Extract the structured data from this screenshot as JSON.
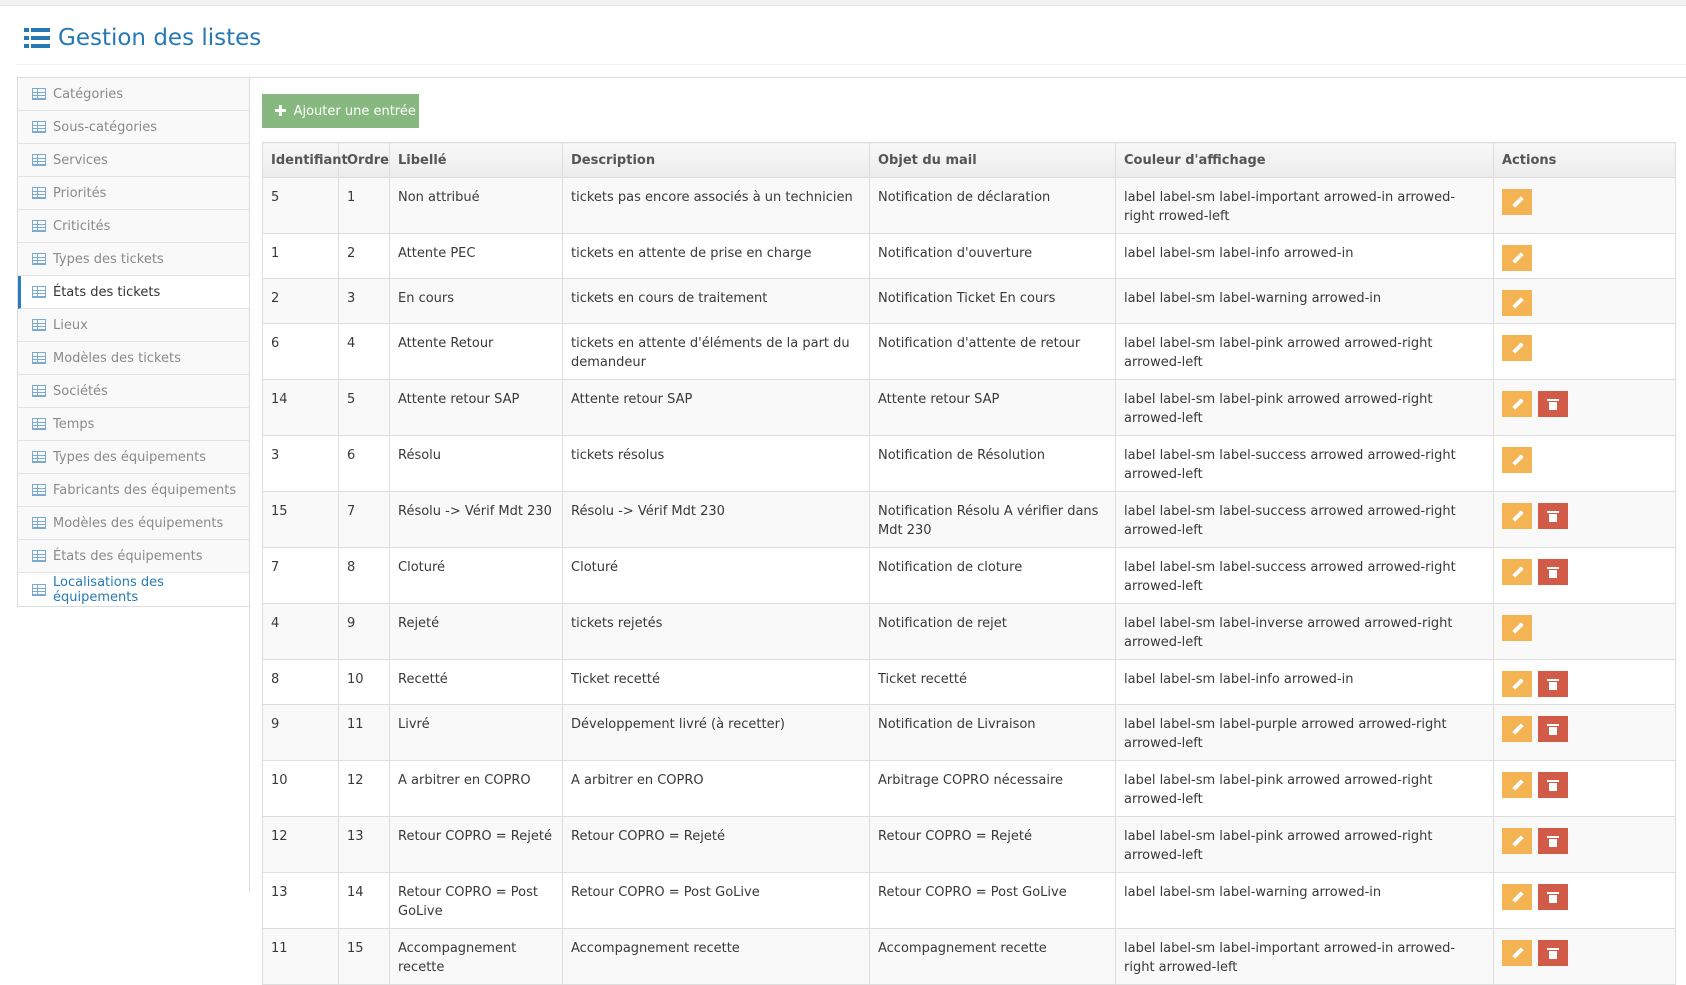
{
  "page": {
    "title": "Gestion des listes"
  },
  "sidebar": {
    "items": [
      {
        "label": "Catégories",
        "state": "normal"
      },
      {
        "label": "Sous-catégories",
        "state": "normal"
      },
      {
        "label": "Services",
        "state": "normal"
      },
      {
        "label": "Priorités",
        "state": "normal"
      },
      {
        "label": "Criticités",
        "state": "normal"
      },
      {
        "label": "Types des tickets",
        "state": "normal"
      },
      {
        "label": "États des tickets",
        "state": "active"
      },
      {
        "label": "Lieux",
        "state": "normal"
      },
      {
        "label": "Modèles des tickets",
        "state": "normal"
      },
      {
        "label": "Sociétés",
        "state": "normal"
      },
      {
        "label": "Temps",
        "state": "normal"
      },
      {
        "label": "Types des équipements",
        "state": "normal"
      },
      {
        "label": "Fabricants des équipements",
        "state": "normal"
      },
      {
        "label": "Modèles des équipements",
        "state": "normal"
      },
      {
        "label": "États des équipements",
        "state": "normal"
      },
      {
        "label": "Localisations des équipements",
        "state": "link"
      }
    ]
  },
  "toolbar": {
    "add_label": "Ajouter une entrée",
    "add_icon": "plus-icon"
  },
  "table": {
    "headers": [
      "Identifiant",
      "Ordre",
      "Libellé",
      "Description",
      "Objet du mail",
      "Couleur d'affichage",
      "Actions"
    ],
    "rows": [
      {
        "id": "5",
        "ordre": "1",
        "libelle": "Non attribué",
        "description": "tickets pas encore associés à un technicien",
        "objet": "Notification de déclaration",
        "couleur": "label label-sm label-important arrowed-in arrowed-right rrowed-left",
        "delete": false,
        "tall": true
      },
      {
        "id": "1",
        "ordre": "2",
        "libelle": "Attente PEC",
        "description": "tickets en attente de prise en charge",
        "objet": "Notification d'ouverture",
        "couleur": "label label-sm label-info arrowed-in",
        "delete": false,
        "tall": false
      },
      {
        "id": "2",
        "ordre": "3",
        "libelle": "En cours",
        "description": "tickets en cours de traitement",
        "objet": "Notification Ticket En cours",
        "couleur": "label label-sm label-warning arrowed-in",
        "delete": false,
        "tall": false
      },
      {
        "id": "6",
        "ordre": "4",
        "libelle": "Attente Retour",
        "description": "tickets en attente d'éléments de la part du demandeur",
        "objet": "Notification d'attente de retour",
        "couleur": "label label-sm label-pink arrowed arrowed-right arrowed-left",
        "delete": false,
        "tall": true
      },
      {
        "id": "14",
        "ordre": "5",
        "libelle": "Attente retour SAP",
        "description": "Attente retour SAP",
        "objet": "Attente retour SAP",
        "couleur": "label label-sm label-pink arrowed arrowed-right arrowed-left",
        "delete": true,
        "tall": false
      },
      {
        "id": "3",
        "ordre": "6",
        "libelle": "Résolu",
        "description": "tickets résolus",
        "objet": "Notification de Résolution",
        "couleur": "label label-sm label-success arrowed arrowed-right arrowed-left",
        "delete": false,
        "tall": false
      },
      {
        "id": "15",
        "ordre": "7",
        "libelle": "Résolu -> Vérif Mdt 230",
        "description": "Résolu -> Vérif Mdt 230",
        "objet": "Notification Résolu A vérifier dans Mdt 230",
        "couleur": "label label-sm label-success arrowed arrowed-right arrowed-left",
        "delete": true,
        "tall": true
      },
      {
        "id": "7",
        "ordre": "8",
        "libelle": "Cloturé",
        "description": "Cloturé",
        "objet": "Notification de cloture",
        "couleur": "label label-sm label-success arrowed arrowed-right arrowed-left",
        "delete": true,
        "tall": false
      },
      {
        "id": "4",
        "ordre": "9",
        "libelle": "Rejeté",
        "description": "tickets rejetés",
        "objet": "Notification de rejet",
        "couleur": "label label-sm label-inverse arrowed arrowed-right arrowed-left",
        "delete": false,
        "tall": false
      },
      {
        "id": "8",
        "ordre": "10",
        "libelle": "Recetté",
        "description": "Ticket recetté",
        "objet": "Ticket recetté",
        "couleur": "label label-sm label-info arrowed-in",
        "delete": true,
        "tall": false
      },
      {
        "id": "9",
        "ordre": "11",
        "libelle": "Livré",
        "description": "Développement livré (à recetter)",
        "objet": "Notification de Livraison",
        "couleur": "label label-sm label-purple arrowed arrowed-right arrowed-left",
        "delete": true,
        "tall": false
      },
      {
        "id": "10",
        "ordre": "12",
        "libelle": "A arbitrer en COPRO",
        "description": "A arbitrer en COPRO",
        "objet": "Arbitrage COPRO nécessaire",
        "couleur": "label label-sm label-pink arrowed arrowed-right arrowed-left",
        "delete": true,
        "tall": false
      },
      {
        "id": "12",
        "ordre": "13",
        "libelle": "Retour COPRO = Rejeté",
        "description": "Retour COPRO = Rejeté",
        "objet": "Retour COPRO = Rejeté",
        "couleur": "label label-sm label-pink arrowed arrowed-right arrowed-left",
        "delete": true,
        "tall": false
      },
      {
        "id": "13",
        "ordre": "14",
        "libelle": "Retour COPRO = Post GoLive",
        "description": "Retour COPRO = Post GoLive",
        "objet": "Retour COPRO = Post GoLive",
        "couleur": "label label-sm label-warning arrowed-in",
        "delete": true,
        "tall": true
      },
      {
        "id": "11",
        "ordre": "15",
        "libelle": "Accompagnement recette",
        "description": "Accompagnement recette",
        "objet": "Accompagnement recette",
        "couleur": "label label-sm label-important arrowed-in arrowed-right arrowed-left",
        "delete": true,
        "tall": true
      }
    ]
  },
  "colors": {
    "accent": "#2679b5",
    "add_button": "#87b87f",
    "edit_button": "#f5b454",
    "delete_button": "#d15b47"
  }
}
